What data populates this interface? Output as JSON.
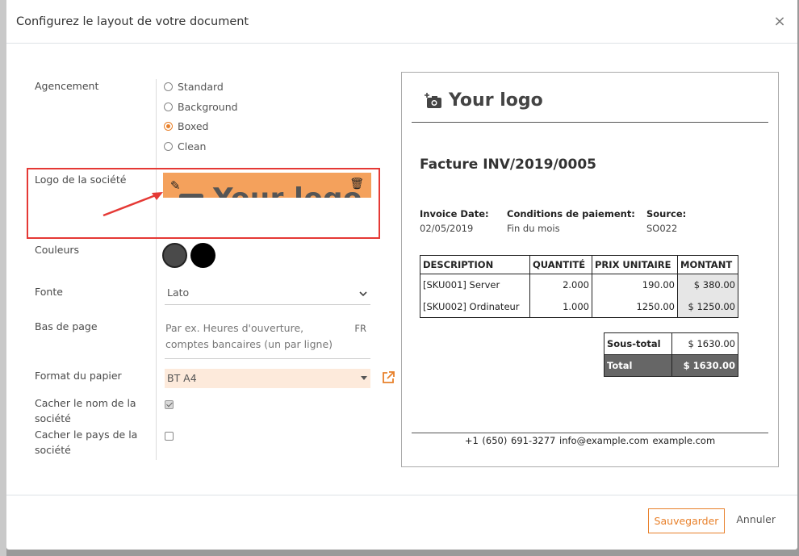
{
  "modal": {
    "title": "Configurez le layout de votre document",
    "close": "×"
  },
  "form": {
    "layout_label": "Agencement",
    "layout_options": [
      "Standard",
      "Background",
      "Boxed",
      "Clean"
    ],
    "layout_selected": "Boxed",
    "logo_label": "Logo de la société",
    "logo_text": "Your logo",
    "colors_label": "Couleurs",
    "colors": [
      "#4a4a4a",
      "#000000"
    ],
    "font_label": "Fonte",
    "font_value": "Lato",
    "footer_label": "Bas de page",
    "footer_placeholder": "Par ex. Heures d'ouverture, comptes bancaires (un par ligne)",
    "footer_lang": "FR",
    "paper_label": "Format du papier",
    "paper_value": "BT A4",
    "hide_name_label": "Cacher le nom de la société",
    "hide_name_checked": true,
    "hide_country_label": "Cacher le pays de la société",
    "hide_country_checked": false
  },
  "preview": {
    "logo_text": "Your logo",
    "invoice_title": "Facture INV/2019/0005",
    "info": [
      {
        "header": "Invoice Date:",
        "value": "02/05/2019"
      },
      {
        "header": "Conditions de paiement:",
        "value": "Fin du mois"
      },
      {
        "header": "Source:",
        "value": "SO022"
      }
    ],
    "columns": [
      "DESCRIPTION",
      "QUANTITÉ",
      "PRIX UNITAIRE",
      "MONTANT"
    ],
    "rows": [
      [
        "[SKU001] Server",
        "2.000",
        "190.00",
        "$ 380.00"
      ],
      [
        "[SKU002] Ordinateur",
        "1.000",
        "1250.00",
        "$ 1250.00"
      ]
    ],
    "subtotal_label": "Sous-total",
    "subtotal_value": "$ 1630.00",
    "total_label": "Total",
    "total_value": "$ 1630.00",
    "footer": "+1 (650) 691-3277 info@example.com example.com"
  },
  "footer": {
    "save_label": "Sauvegarder",
    "cancel_label": "Annuler"
  },
  "accent_color": "#e8802a",
  "highlight_color": "#e53935"
}
